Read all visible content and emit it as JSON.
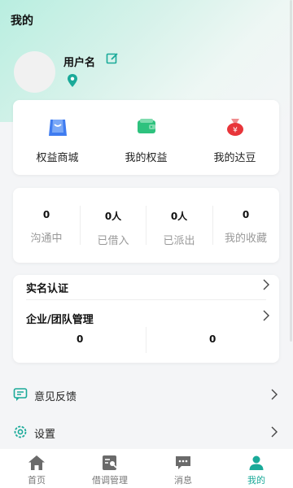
{
  "header": {
    "title": "我的"
  },
  "profile": {
    "username": "用户名"
  },
  "quick_actions": [
    {
      "label": "权益商城",
      "icon": "shopping-bag-icon",
      "color": "#3f7cf0"
    },
    {
      "label": "我的权益",
      "icon": "wallet-icon",
      "color": "#2ec27e"
    },
    {
      "label": "我的达豆",
      "icon": "money-bag-icon",
      "color": "#e8353a"
    }
  ],
  "stats": [
    {
      "value": "0",
      "label": "沟通中"
    },
    {
      "value": "0人",
      "label": "已借入"
    },
    {
      "value": "0人",
      "label": "已派出"
    },
    {
      "value": "0",
      "label": "我的收藏"
    }
  ],
  "auth": {
    "real_name": "实名认证",
    "team": "企业/团队管理",
    "values": [
      "0",
      "0"
    ]
  },
  "menu": [
    {
      "label": "意见反馈",
      "icon": "feedback-icon"
    },
    {
      "label": "设置",
      "icon": "settings-icon"
    }
  ],
  "tabs": [
    {
      "label": "首页",
      "icon": "home-icon"
    },
    {
      "label": "借调管理",
      "icon": "transfer-manage-icon"
    },
    {
      "label": "消息",
      "icon": "message-icon"
    },
    {
      "label": "我的",
      "icon": "profile-icon",
      "active": true
    }
  ],
  "colors": {
    "accent": "#1aaa99",
    "hero_gradient": "#b9eee0"
  }
}
